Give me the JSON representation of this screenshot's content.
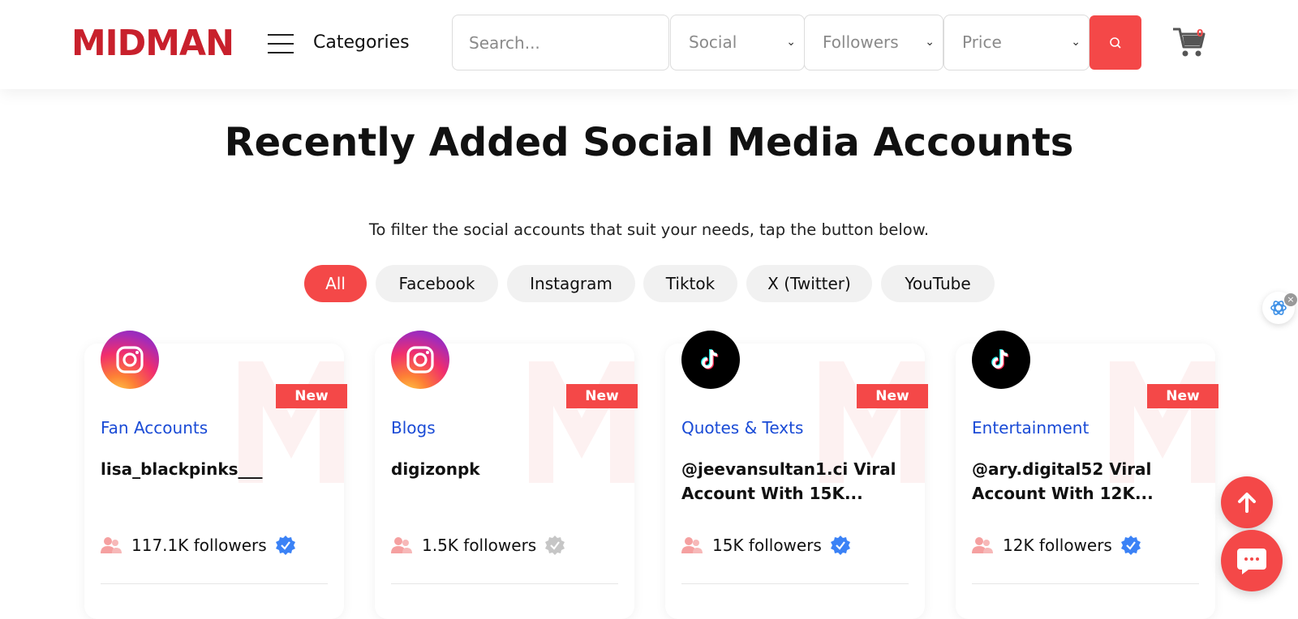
{
  "header": {
    "logo_text": "MIDMAN",
    "categories_label": "Categories",
    "search_placeholder": "Search...",
    "filters": [
      {
        "label": "Social"
      },
      {
        "label": "Followers"
      },
      {
        "label": "Price"
      }
    ],
    "cart_count": "0"
  },
  "main": {
    "title": "Recently Added Social Media Accounts",
    "subtitle": "To filter the social accounts that suit your needs, tap the button below.",
    "chips": [
      {
        "label": "All",
        "active": true
      },
      {
        "label": "Facebook"
      },
      {
        "label": "Instagram"
      },
      {
        "label": "Tiktok"
      },
      {
        "label": "X (Twitter)"
      },
      {
        "label": "YouTube"
      }
    ]
  },
  "cards": [
    {
      "platform": "instagram",
      "badge": "New",
      "category": "Fan Accounts",
      "name": "lisa_blackpinks___",
      "followers": "117.1K followers",
      "verified": "blue"
    },
    {
      "platform": "instagram",
      "badge": "New",
      "category": "Blogs",
      "name": "digizonpk",
      "followers": "1.5K followers",
      "verified": "gray"
    },
    {
      "platform": "tiktok",
      "badge": "New",
      "category": "Quotes & Texts",
      "name": "@jeevansultan1.ci Viral Account With 15K...",
      "followers": "15K followers",
      "verified": "blue"
    },
    {
      "platform": "tiktok",
      "badge": "New",
      "category": "Entertainment",
      "name": "@ary.digital52 Viral Account With 12K...",
      "followers": "12K followers",
      "verified": "blue"
    }
  ],
  "colors": {
    "accent": "#f44848",
    "brand_red": "#c8202c",
    "link_blue": "#1a4bd6",
    "verify_blue": "#3b82f6",
    "verify_gray": "#c6c6c6"
  },
  "icons": {
    "menu": "hamburger-icon",
    "search": "search-icon",
    "cart": "cart-icon",
    "scroll_top": "arrow-up-icon",
    "chat": "chat-icon",
    "ai": "openai-icon"
  }
}
